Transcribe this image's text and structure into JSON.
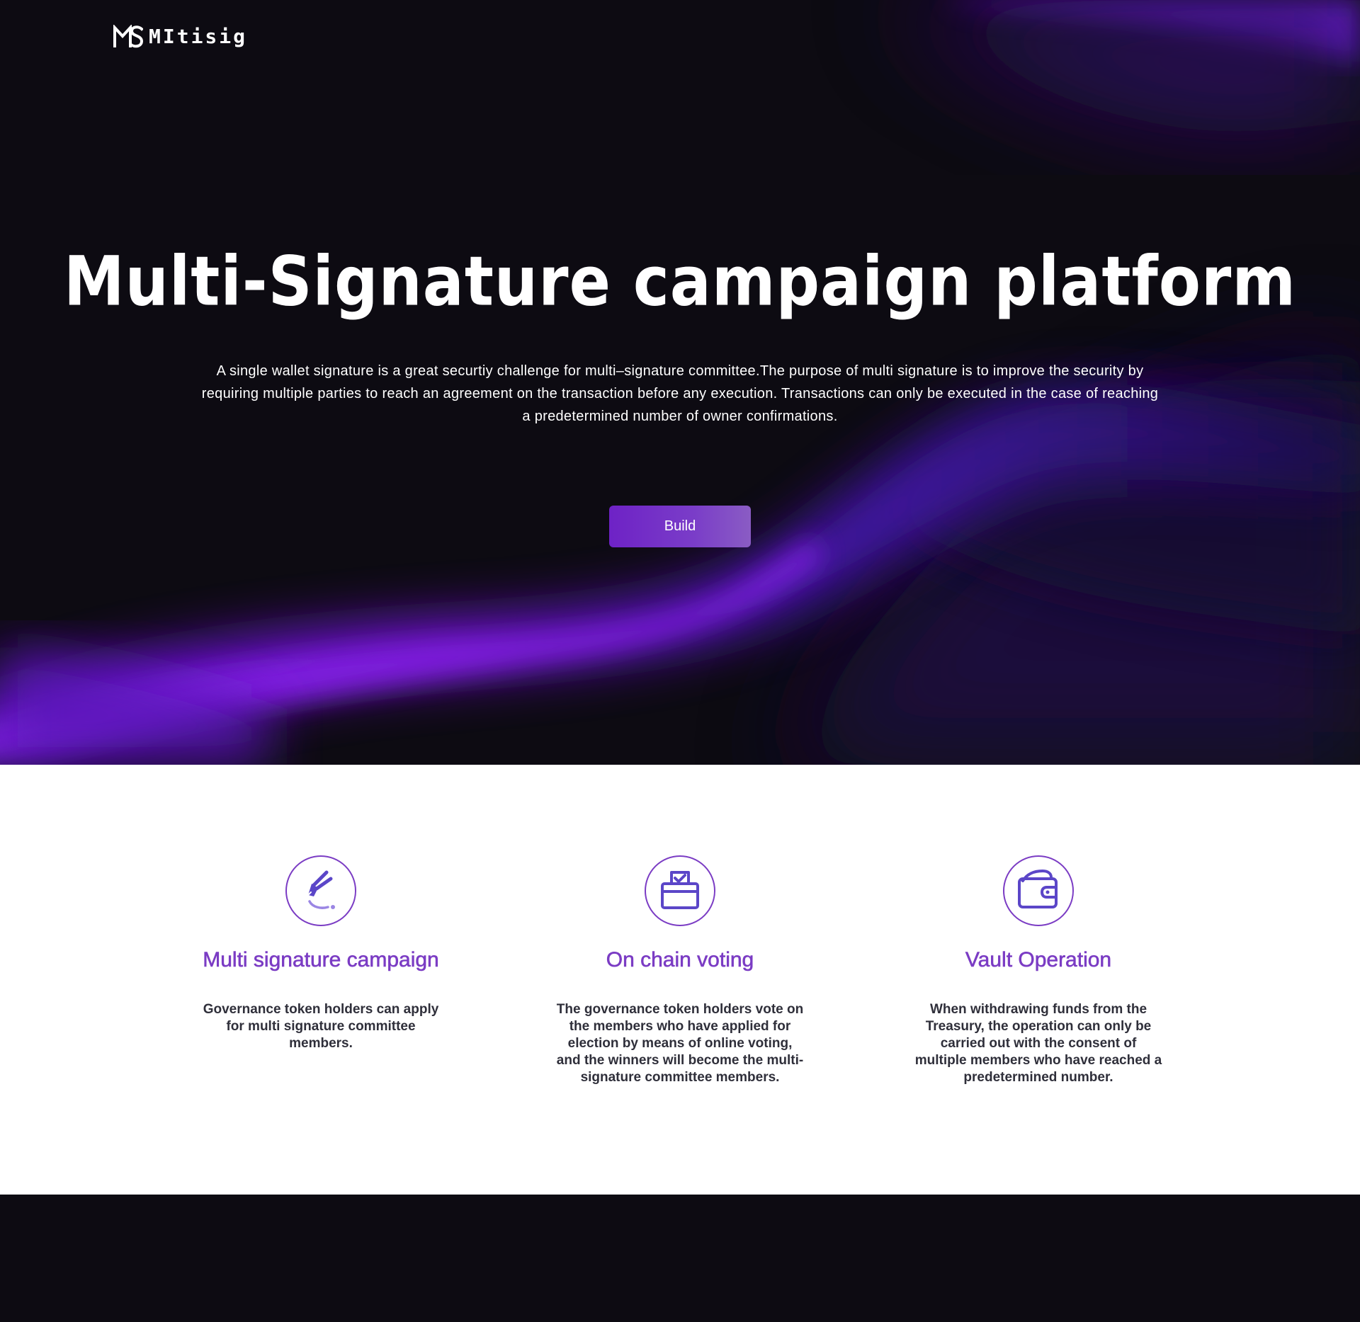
{
  "brand": {
    "name": "MItisig",
    "logo_icon": "ms-monogram-icon"
  },
  "hero": {
    "title": "Multi-Signature campaign platform",
    "description": "A single wallet signature is a great securtiy challenge for multi–signature committee.The purpose of multi signature is to improve the security by requiring multiple parties to reach an agreement on the transaction before any execution. Transactions can only be executed in the case of reaching a predetermined number of owner confirmations.",
    "cta_label": "Build"
  },
  "features": [
    {
      "icon": "pen-signature-icon",
      "title": "Multi signature campaign",
      "description": "Governance token holders can apply for multi signature committee members."
    },
    {
      "icon": "ballot-box-icon",
      "title": "On chain voting",
      "description": "The governance token holders vote on the members who have applied for election by means of online voting, and the winners will become the multi-signature committee members."
    },
    {
      "icon": "wallet-icon",
      "title": "Vault Operation",
      "description": "When withdrawing funds from the Treasury, the operation can only be carried out with the consent of multiple members who have reached a predetermined number."
    }
  ],
  "colors": {
    "background_dark": "#0d0b12",
    "accent_purple": "#7b3cc4",
    "glow_purple": "#7a18e6",
    "icon_indigo": "#5b46c8",
    "body_text": "#2f2f3a",
    "white": "#ffffff"
  }
}
